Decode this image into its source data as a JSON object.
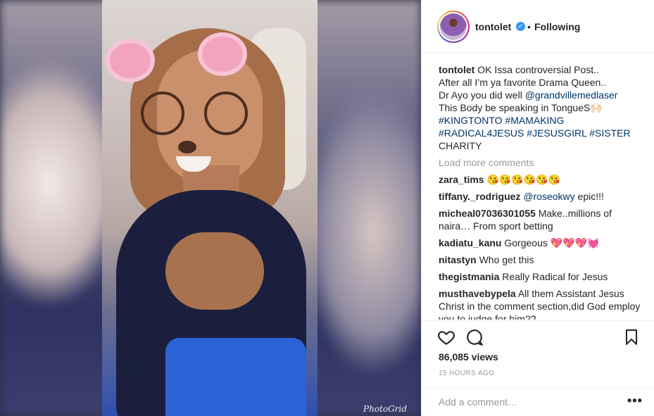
{
  "post": {
    "username": "tontolet",
    "verified_symbol": "✓",
    "separator": "•",
    "follow_status": "Following",
    "watermark": "PhotoGrid"
  },
  "caption": {
    "user": "tontolet",
    "line1": "OK Issa controversial Post..",
    "line2": "After all I’m ya favorite Drama Queen..",
    "line3_text": "Dr Ayo you did well ",
    "line3_mention": "@grandvillemedlaser",
    "line4": "This Body be speaking in TongueS🙌🏻",
    "tags1": [
      "#KINGTONTO",
      "#MAMAKING"
    ],
    "tags2": [
      "#RADICAL4JESUS",
      "#JESUSGIRL",
      "#SISTER"
    ],
    "line_end": "CHARITY"
  },
  "load_more": "Load more comments",
  "comments": [
    {
      "user": "zara_tims",
      "text": "😘😘😘😘😘😘"
    },
    {
      "user": "tiffany._rodriguez",
      "mention": "@roseokwy",
      "text": " epic!!!"
    },
    {
      "user": "micheal07036301055",
      "text": "Make..millions of naira… From sport betting"
    },
    {
      "user": "kadiatu_kanu",
      "text": "Gorgeous 💖💖💖💓"
    },
    {
      "user": "nitastyn",
      "text": "Who get this"
    },
    {
      "user": "thegistmania",
      "text": "Really Radical for Jesus"
    },
    {
      "user": "musthavebypela",
      "text": "All them Assistant Jesus Christ in the comment section,did God employ you to judge for him??"
    }
  ],
  "actions": {
    "like_icon": "heart-icon",
    "comment_icon": "comment-icon",
    "save_icon": "bookmark-icon"
  },
  "stats": {
    "views": "86,085 views",
    "timestamp": "15 HOURS AGO"
  },
  "add_comment": {
    "placeholder": "Add a comment…",
    "more_label": "•••"
  }
}
